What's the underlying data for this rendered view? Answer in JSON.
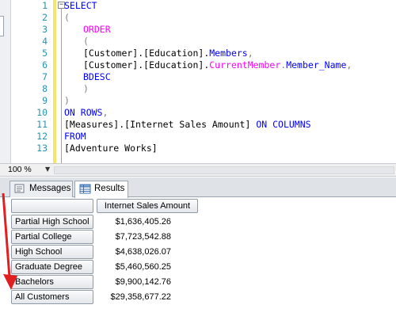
{
  "editor": {
    "line_numbers": [
      "1",
      "2",
      "3",
      "4",
      "5",
      "6",
      "7",
      "8",
      "9",
      "10",
      "11",
      "12",
      "13"
    ],
    "lines": {
      "l1_kw": "SELECT",
      "l2": "(",
      "l3_fn": "ORDER",
      "l4": "(",
      "l5_a": "[Customer].[Education].",
      "l5_b": "Members",
      "l5_c": ",",
      "l6_a": "[Customer].[Education].",
      "l6_b": "CurrentMember",
      "l6_c": ".",
      "l6_d": "Member_Name",
      "l6_e": ",",
      "l7_kw": "BDESC",
      "l8": ")",
      "l9": ")",
      "l10_kw": "ON ROWS",
      "l10_c": ",",
      "l11_a": "[Measures].[Internet Sales Amount] ",
      "l11_kw": "ON COLUMNS",
      "l12_kw": "FROM",
      "l13": "[Adventure Works]"
    }
  },
  "zoom": {
    "value": "100 %"
  },
  "results": {
    "tabs": [
      {
        "label": "Messages",
        "icon": "messages-icon"
      },
      {
        "label": "Results",
        "icon": "grid-icon"
      }
    ],
    "column_header": "Internet Sales Amount",
    "rows": [
      {
        "label": "Partial High School",
        "value": "$1,636,405.26"
      },
      {
        "label": "Partial College",
        "value": "$7,723,542.88"
      },
      {
        "label": "High School",
        "value": "$4,638,026.07"
      },
      {
        "label": "Graduate Degree",
        "value": "$5,460,560.25"
      },
      {
        "label": "Bachelors",
        "value": "$9,900,142.76"
      },
      {
        "label": "All Customers",
        "value": "$29,358,677.22"
      }
    ]
  },
  "colors": {
    "keyword": "#0000ff",
    "function": "#ff00ff",
    "operator": "#808080",
    "line_number": "#2b91af",
    "annotation_arrow": "#e02020"
  }
}
